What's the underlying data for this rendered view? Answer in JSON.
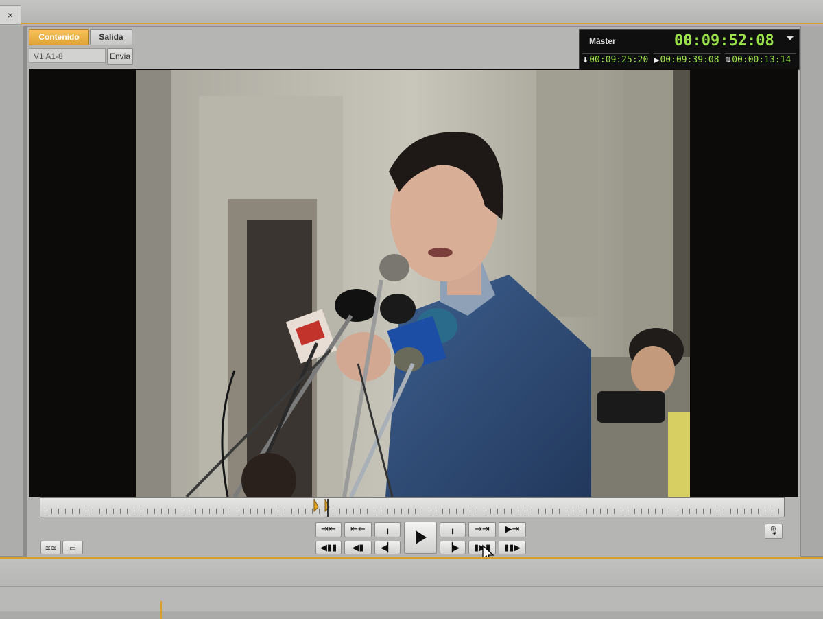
{
  "window": {
    "close_glyph": "×"
  },
  "source_tabs": {
    "content_label": "Contenido",
    "output_label": "Salida"
  },
  "track": {
    "value": "V1 A1-8",
    "send_label": "Envia"
  },
  "timecode": {
    "label": "Máster",
    "main": "00:09:52:08",
    "mark_in": "00:09:25:20",
    "mark_out": "00:09:39:08",
    "duration": "00:00:13:14"
  },
  "scrubber": {
    "playhead_fraction": 0.37
  },
  "colors": {
    "accent": "#d9a02b",
    "timecode_green": "#9be24a"
  },
  "transport_icons": [
    "mark-clip-icon",
    "go-to-in-icon",
    "mark-in-icon",
    "play-icon",
    "mark-out-icon",
    "go-to-out-icon",
    "go-to-end-icon",
    "step-back-10-icon",
    "go-to-previous-edit-icon",
    "step-back-icon",
    "step-forward-icon",
    "play-in-to-out-icon",
    "go-to-next-edit-icon"
  ]
}
